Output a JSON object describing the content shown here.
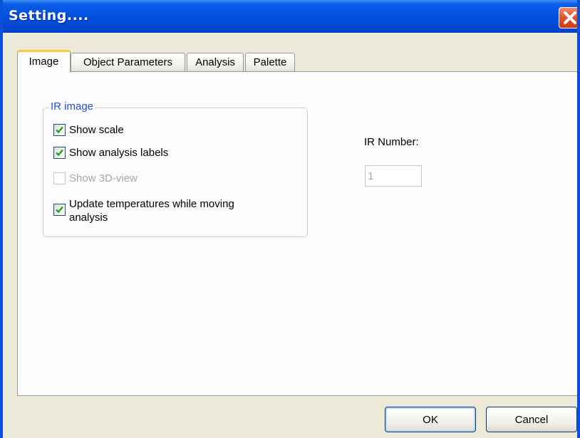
{
  "window": {
    "title": "Setting....",
    "close_icon": "close-icon"
  },
  "tabs": [
    {
      "label": "Image",
      "active": true
    },
    {
      "label": "Object Parameters",
      "active": false
    },
    {
      "label": "Analysis",
      "active": false
    },
    {
      "label": "Palette",
      "active": false
    }
  ],
  "image_tab": {
    "ir_group": {
      "title": "IR image",
      "options": [
        {
          "label": "Show scale",
          "checked": true,
          "enabled": true
        },
        {
          "label": "Show analysis labels",
          "checked": true,
          "enabled": true
        },
        {
          "label": "Show 3D-view",
          "checked": false,
          "enabled": false
        },
        {
          "label": "Update temperatures while moving analysis",
          "checked": true,
          "enabled": true
        }
      ]
    },
    "ir_number": {
      "label": "IR Number:",
      "value": "1",
      "enabled": false
    }
  },
  "buttons": {
    "ok": "OK",
    "cancel": "Cancel"
  },
  "colors": {
    "titlebar": "#0550e0",
    "window_border": "#0a50d8",
    "close_button": "#e2512a",
    "active_tab_accent": "#ffc83c",
    "group_title": "#1f4ed8",
    "checkmark": "#21a121",
    "disabled_text": "#aca899"
  }
}
